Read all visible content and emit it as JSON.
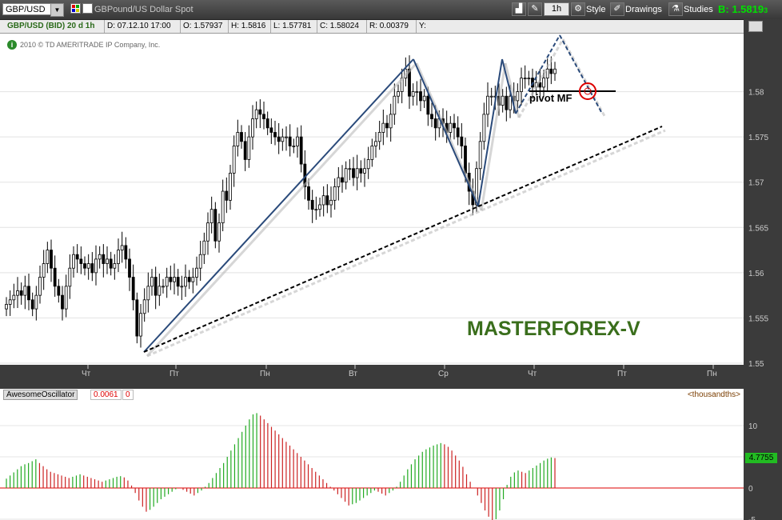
{
  "toolbar": {
    "symbol": "GBP/USD",
    "description": "GBPound/US Dollar Spot",
    "interval": "1h",
    "style_label": "Style",
    "drawings_label": "Drawings",
    "studies_label": "Studies",
    "bid_label": "B:",
    "bid_value": "1.5819",
    "bid_fraction": "3"
  },
  "info": {
    "title": "GBP/USD (BID) 20 d 1h",
    "date": "D: 07.12.10 17:00",
    "open": "O: 1.57937",
    "high": "H: 1.5816",
    "low": "L: 1.57781",
    "close": "C: 1.58024",
    "range": "R: 0.00379",
    "y": "Y:"
  },
  "copyright": "2010 © TD AMERITRADE IP Company, Inc.",
  "watermark": "MASTERFOREX-V",
  "annotation": "pivot MF",
  "colors": {
    "up": "#22aa22",
    "down": "#cc2222",
    "candle": "#000000",
    "line": "#2a4a7a",
    "watermark": "#3a6e1c"
  },
  "chart_data": [
    {
      "type": "candlestick",
      "ylim": [
        1.55,
        1.585
      ],
      "yticks": [
        "1.58",
        "1.575",
        "1.57",
        "1.565",
        "1.56",
        "1.555",
        "1.55"
      ],
      "xticks": [
        "Чт",
        "Пт",
        "Пн",
        "Вт",
        "Ср",
        "Чт",
        "Пт",
        "Пн"
      ],
      "close_series": [
        1.5565,
        1.557,
        1.5575,
        1.558,
        1.5575,
        1.5585,
        1.557,
        1.556,
        1.5575,
        1.5595,
        1.561,
        1.5625,
        1.5605,
        1.5585,
        1.5575,
        1.556,
        1.5585,
        1.5605,
        1.562,
        1.5615,
        1.561,
        1.5605,
        1.561,
        1.56,
        1.5615,
        1.562,
        1.561,
        1.5615,
        1.5605,
        1.561,
        1.5625,
        1.563,
        1.5615,
        1.5595,
        1.557,
        1.553,
        1.5555,
        1.557,
        1.5585,
        1.5595,
        1.5575,
        1.5585,
        1.5585,
        1.5595,
        1.559,
        1.5595,
        1.5585,
        1.5585,
        1.5595,
        1.559,
        1.5595,
        1.5605,
        1.562,
        1.5635,
        1.5655,
        1.567,
        1.5635,
        1.5655,
        1.569,
        1.568,
        1.571,
        1.574,
        1.5755,
        1.5745,
        1.5725,
        1.575,
        1.577,
        1.578,
        1.5775,
        1.577,
        1.576,
        1.5755,
        1.575,
        1.5745,
        1.575,
        1.575,
        1.574,
        1.574,
        1.575,
        1.572,
        1.5695,
        1.568,
        1.567,
        1.567,
        1.5675,
        1.5685,
        1.5675,
        1.568,
        1.5695,
        1.5705,
        1.57,
        1.5715,
        1.5715,
        1.5705,
        1.5715,
        1.571,
        1.5715,
        1.5725,
        1.574,
        1.5745,
        1.5755,
        1.5765,
        1.576,
        1.5775,
        1.5795,
        1.58,
        1.5815,
        1.5825,
        1.5795,
        1.58,
        1.58,
        1.579,
        1.5795,
        1.5775,
        1.577,
        1.576,
        1.577,
        1.5765,
        1.5755,
        1.5765,
        1.576,
        1.575,
        1.574,
        1.571,
        1.569,
        1.5675,
        1.5715,
        1.5745,
        1.5775,
        1.5795,
        1.5795,
        1.5795,
        1.5785,
        1.5795,
        1.578,
        1.5795,
        1.579,
        1.58,
        1.5815,
        1.5815,
        1.5815,
        1.5805,
        1.581,
        1.5805,
        1.5815,
        1.5825,
        1.582,
        1.5825
      ],
      "trend_lines": [
        "zigzag",
        "dashed-support",
        "dashed-projection"
      ],
      "pivot_circle": "pivot MF"
    },
    {
      "type": "bar",
      "name": "AwesomeOscillator",
      "value_label": "0.0061",
      "extra_label": "0",
      "units_label": "<thousandths>",
      "current_value": "4.7755",
      "ylim": [
        -5.5,
        12
      ],
      "yticks": [
        "10",
        "5",
        "0",
        "-5"
      ],
      "values": [
        1.5,
        2.0,
        2.5,
        3.0,
        3.5,
        3.8,
        4.0,
        4.3,
        4.6,
        4.0,
        3.5,
        3.0,
        2.6,
        2.4,
        2.2,
        2.0,
        1.8,
        1.6,
        1.8,
        2.0,
        2.2,
        2.0,
        1.8,
        1.6,
        1.4,
        1.2,
        1.0,
        1.2,
        1.4,
        1.6,
        1.8,
        1.9,
        1.7,
        1.2,
        0.4,
        -0.8,
        -2.0,
        -3.0,
        -3.8,
        -3.5,
        -3.0,
        -2.4,
        -1.8,
        -1.4,
        -1.0,
        -0.6,
        -0.2,
        0.0,
        -0.3,
        -0.6,
        -0.9,
        -1.2,
        -0.8,
        -0.4,
        0.2,
        0.8,
        1.6,
        2.4,
        3.2,
        4.0,
        5.0,
        6.0,
        7.0,
        8.0,
        9.0,
        10.0,
        11.0,
        11.8,
        12.0,
        11.6,
        11.0,
        10.4,
        9.8,
        9.2,
        8.6,
        8.0,
        7.4,
        6.8,
        6.2,
        5.6,
        5.0,
        4.4,
        3.8,
        3.2,
        2.6,
        2.0,
        1.4,
        0.8,
        0.2,
        -0.4,
        -1.0,
        -1.6,
        -2.2,
        -2.8,
        -2.6,
        -2.4,
        -2.0,
        -1.6,
        -1.2,
        -0.8,
        -0.4,
        -0.6,
        -0.9,
        -1.2,
        -0.8,
        -0.4,
        0.2,
        1.0,
        2.0,
        3.0,
        3.8,
        4.6,
        5.2,
        5.8,
        6.2,
        6.5,
        6.8,
        7.0,
        7.2,
        7.0,
        6.6,
        6.0,
        5.2,
        4.4,
        3.4,
        2.2,
        1.0,
        0.0,
        -1.2,
        -2.4,
        -3.6,
        -4.6,
        -5.3,
        -5.0,
        -3.6,
        -1.8,
        0.5,
        1.8,
        2.5,
        2.8,
        2.6,
        2.4,
        2.8,
        3.2,
        3.6,
        4.0,
        4.4,
        4.7,
        4.9,
        4.8
      ]
    }
  ]
}
